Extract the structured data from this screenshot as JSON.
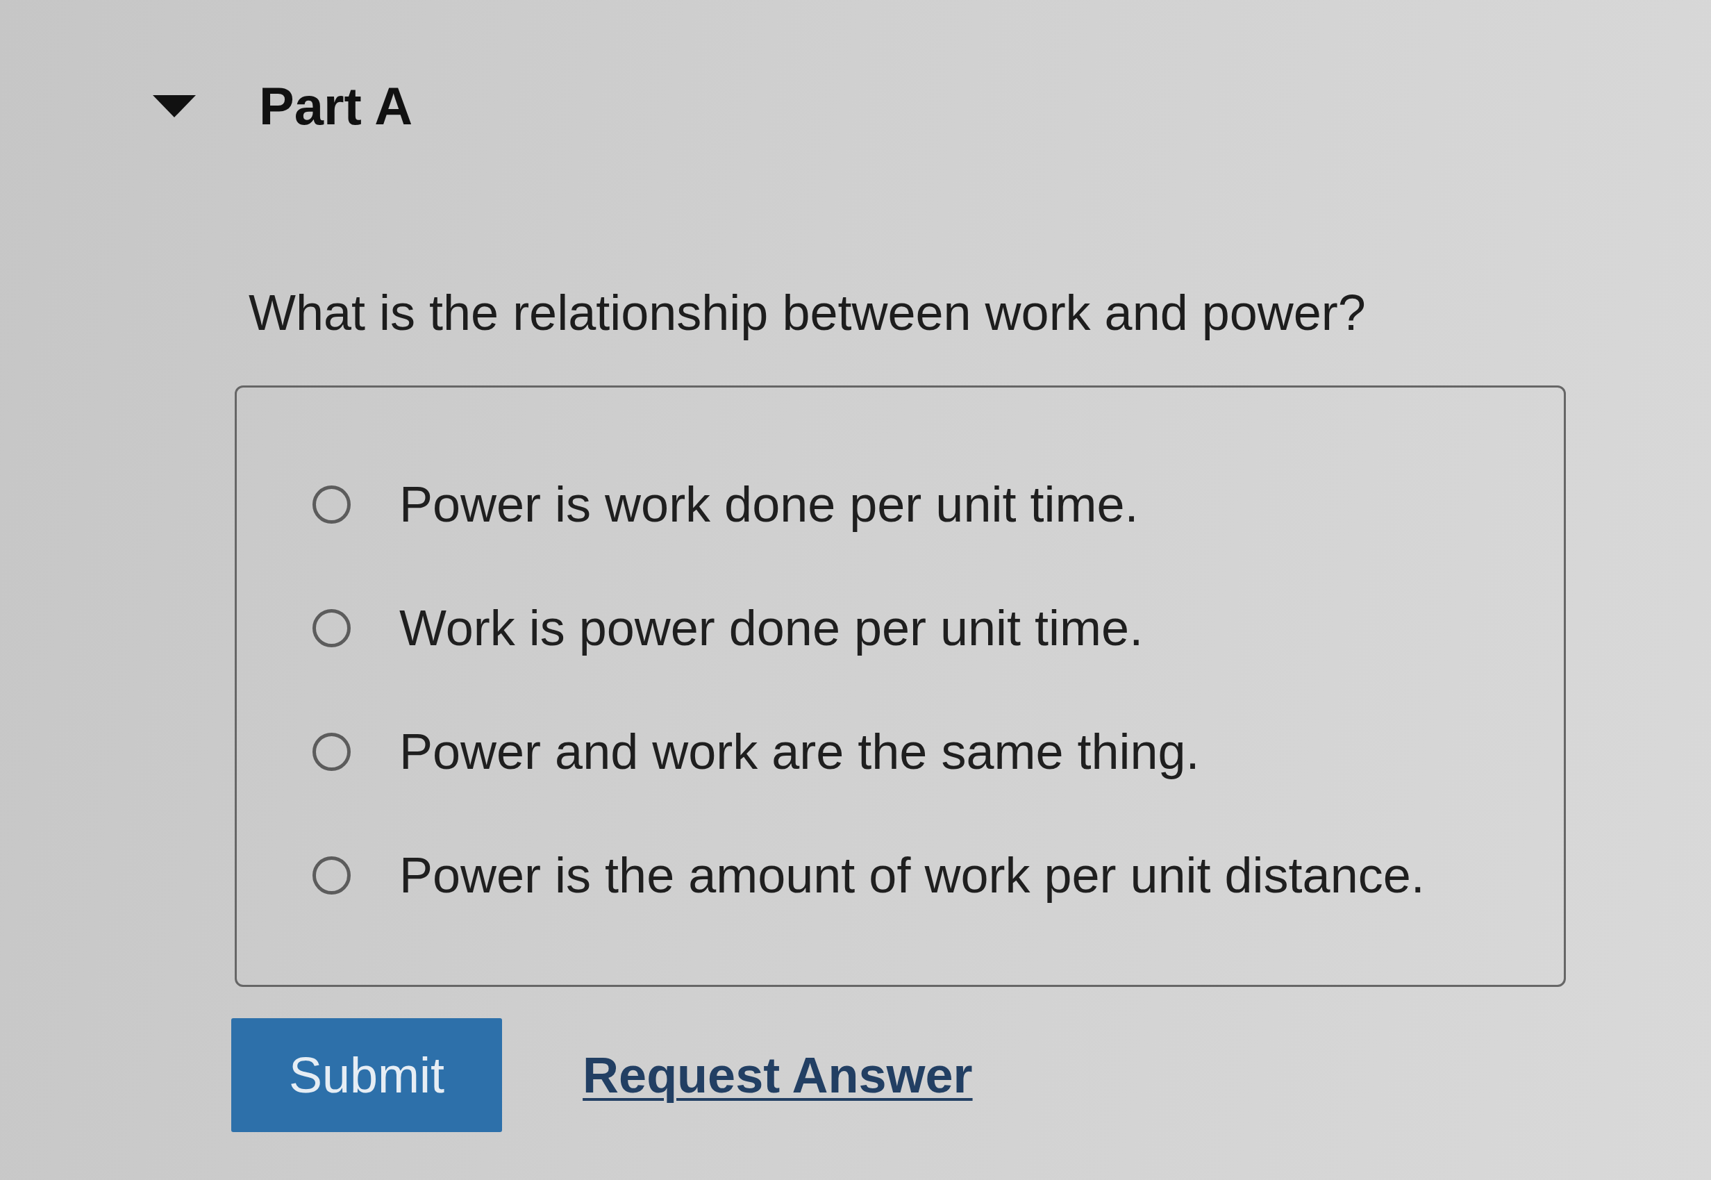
{
  "section": {
    "title": "Part A",
    "expanded": true
  },
  "question": "What is the relationship between work and power?",
  "options": [
    {
      "label": "Power is work done per unit time.",
      "selected": false
    },
    {
      "label": "Work is power done per unit time.",
      "selected": false
    },
    {
      "label": "Power and work are the same thing.",
      "selected": false
    },
    {
      "label": "Power is the amount of work per unit distance.",
      "selected": false
    }
  ],
  "actions": {
    "submit": "Submit",
    "request_answer": "Request Answer"
  }
}
